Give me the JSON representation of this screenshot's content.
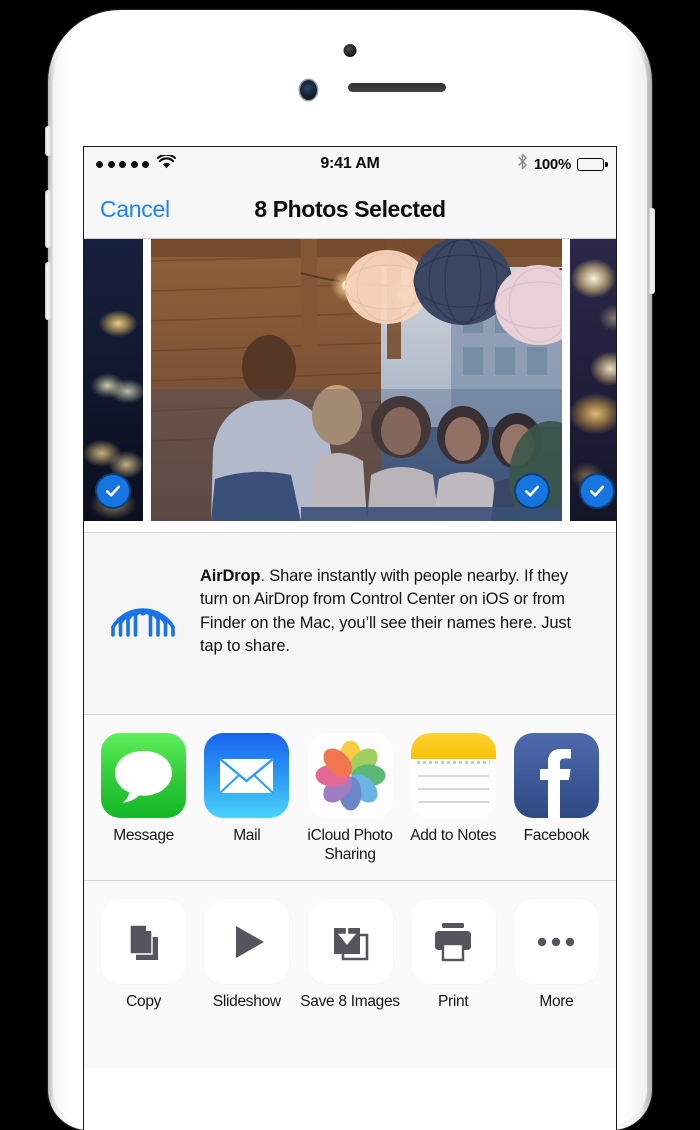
{
  "device": {
    "name": "iphone-white",
    "sensors": [
      "proximity-sensor",
      "front-camera",
      "earpiece-speaker"
    ],
    "buttons": [
      "mute-switch",
      "volume-up",
      "volume-down",
      "power"
    ]
  },
  "status_bar": {
    "signal_dots": 5,
    "wifi": "wifi-icon",
    "time": "9:41 AM",
    "bluetooth": "bluetooth-icon",
    "battery_percent": "100%",
    "battery": "battery-full-icon"
  },
  "nav_bar": {
    "cancel_label": "Cancel",
    "title": "8 Photos Selected",
    "cancel_color": "#1a82ff"
  },
  "photo_strip": {
    "photos": [
      {
        "name": "night-lights-photo",
        "selected": true,
        "partial": "left"
      },
      {
        "name": "rooftop-party-photo",
        "selected": true,
        "partial": "none"
      },
      {
        "name": "golden-star-lights-photo",
        "selected": true,
        "partial": "right"
      }
    ],
    "check_color": "#1675e0"
  },
  "airdrop": {
    "icon": "airdrop-icon",
    "icon_color": "#1a72e8",
    "title": "AirDrop",
    "body": ". Share instantly with people nearby. If they turn on AirDrop from Control Center on iOS or from Finder on the Mac, you’ll see their names here. Just tap to share."
  },
  "app_row": {
    "items": [
      {
        "label": "Message",
        "icon": "messages-app-icon",
        "color": "#34cc3a"
      },
      {
        "label": "Mail",
        "icon": "mail-app-icon",
        "color": "#2c9ef4"
      },
      {
        "label": "iCloud Photo Sharing",
        "icon": "photos-app-icon",
        "color": "#ffffff"
      },
      {
        "label": "Add to Notes",
        "icon": "notes-app-icon",
        "color": "#fcc008"
      },
      {
        "label": "Facebook",
        "icon": "facebook-app-icon",
        "color": "#3b5998"
      }
    ]
  },
  "action_row": {
    "items": [
      {
        "label": "Copy",
        "icon": "copy-icon"
      },
      {
        "label": "Slideshow",
        "icon": "play-icon"
      },
      {
        "label": "Save 8 Images",
        "icon": "save-download-icon"
      },
      {
        "label": "Print",
        "icon": "printer-icon"
      },
      {
        "label": "More",
        "icon": "more-ellipsis-icon"
      }
    ],
    "icon_color": "#55565d"
  }
}
